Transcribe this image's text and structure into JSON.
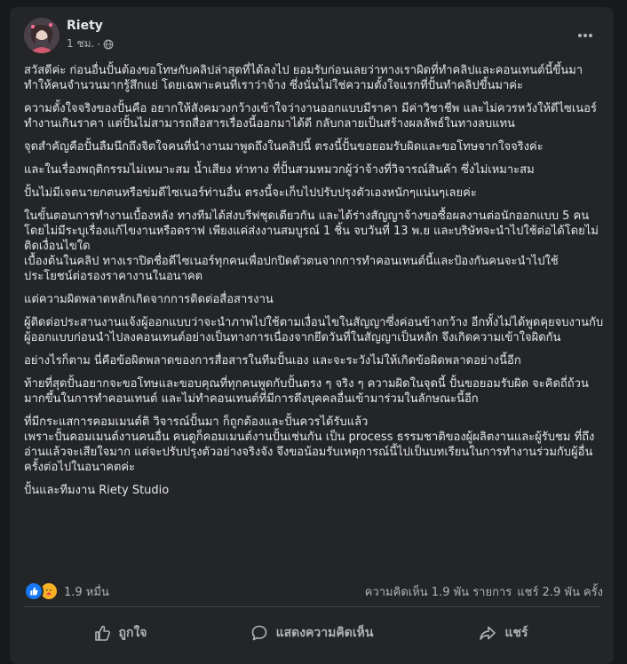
{
  "post": {
    "author": "Riety",
    "time": "1 ชม.",
    "separator": "·",
    "privacy_icon": "globe-icon",
    "paragraphs": [
      "สวัสดีค่ะ ก่อนอื่นปั้นต้องขอโทษกับคลิปล่าสุดที่ได้ลงไป ยอมรับก่อนเลยว่าทางเราผิดที่ทำคลิปและคอนเทนต์นี้ขึ้นมา ทำให้คนจำนวนมากรู้สึกแย่ โดยเฉพาะคนที่เราว่าจ้าง ซึ่งนั่นไม่ใช่ความตั้งใจแรกที่ปั้นทำคลิปขึ้นมาค่ะ",
      "ความตั้งใจจริงของปั้นคือ อยากให้สังคมวงกว้างเข้าใจว่างานออกแบบมีราคา มีค่าวิชาชีพ และไม่ควรหวังให้ดีไซเนอร์ทำงานเกินราคา แต่ปั้นไม่สามารถสื่อสารเรื่องนี้ออกมาได้ดี กลับกลายเป็นสร้างผลลัพธ์ในทางลบแทน",
      "จุดสำคัญคือปั้นลืมนึกถึงจิตใจคนที่นำงานมาพูดถึงในคลิปนี้ ตรงนี้ปั้นขอยอมรับผิดและขอโทษจากใจจริงค่ะ",
      "และในเรื่องพฤติกรรมไม่เหมาะสม น้ำเสียง ท่าทาง ที่ปั้นสวมหมวกผู้ว่าจ้างที่วิจารณ์สินค้า ซึ่งไม่เหมาะสม",
      "ปั้นไม่มีเจตนายกตนหรือข่มดีไซเนอร์ท่านอื่น ตรงนี้จะเก็บไปปรับปรุงตัวเองหนักๆแน่นๆเลยค่ะ",
      "ในขั้นตอนการทำงานเบื้องหลัง ทางทีมได้ส่งบรีฟชุดเดียวกัน และได้ร่างสัญญาจ้างขอซื้อผลงานต่อนักออกแบบ 5 คน โดยไม่มีระบุเรื่องแก้ไขงานหรือดราฟ เพียงแค่ส่งงานสมบูรณ์ 1 ชิ้น จบวันที่ 13 พ.ย และบริษัทจะนำไปใช้ต่อได้โดยไม่ติดเงื่อนไขใด\nเบื้องต้นในคลิป ทางเราปิดชื่อดีไซเนอร์ทุกคนเพื่อปกปิดตัวตนจากการทำคอนเทนต์นี้และป้องกันคนจะนำไปใช้ประโยชน์ต่อรองราคางานในอนาคต",
      "แต่ความผิดพลาดหลักเกิดจากการติดต่อสื่อสารงาน",
      "ผู้ติดต่อประสานงานแจ้งผู้ออกแบบว่าจะนำภาพไปใช้ตามเงื่อนไขในสัญญาซึ่งค่อนข้างกว้าง อีกทั้งไม่ได้พูดคุยจบงานกับผู้ออกแบบก่อนนำไปลงคอนเทนต์อย่างเป็นทางการเนื่องจากยึดวันที่ในสัญญาเป็นหลัก จึงเกิดความเข้าใจผิดกัน",
      "อย่างไรก็ตาม นี่คือข้อผิดพลาดของการสื่อสารในทีมปั้นเอง และจะระวังไม่ให้เกิดข้อผิดพลาดอย่างนี้อีก",
      "ท้ายที่สุดปั้นอยากจะขอโทษและขอบคุณที่ทุกคนพูดกับปั้นตรง ๆ จริง ๆ ความผิดในจุดนี้ ปั้นขอยอมรับผิด จะคิดถี่ถ้วนมากขึ้นในการทำคอนเทนต์ และไม่ทำคอนเทนต์ที่มีการดึงบุคคลอื่นเข้ามาร่วมในลักษณะนี้อีก",
      "ที่มีกระแสการคอมเมนต์ติ วิจารณ์ปั้นมา ก็ถูกต้องและปั้นควรได้รับแล้ว\nเพราะปั้นคอมเมนต์งานคนอื่น คนดูก็คอมเมนต์งานปั้นเช่นกัน เป็น process ธรรมชาติของผู้ผลิตงานและผู้รับชม ที่ถึงอ่านแล้วจะเสียใจมาก แต่จะปรับปรุงตัวอย่างจริงจัง จึงขอน้อมรับเหตุการณ์นี้ไปเป็นบทเรียนในการทำงานร่วมกับผู้อื่นครั้งต่อไปในอนาคตค่ะ",
      "ปั้นและทีมงาน Riety Studio"
    ]
  },
  "stats": {
    "reaction_count": "1.9 หมื่น",
    "reactions": [
      "like",
      "care"
    ],
    "comments": "ความคิดเห็น 1.9 พัน รายการ",
    "shares": "แชร์ 2.9 พัน ครั้ง"
  },
  "actions": {
    "like": "ถูกใจ",
    "comment": "แสดงความคิดเห็น",
    "share": "แชร์"
  },
  "colors": {
    "background": "#18191a",
    "card": "#242526",
    "text_primary": "#e4e6eb",
    "text_secondary": "#b0b3b8",
    "like_blue": "#1877f2",
    "care_yellow": "#f7b125"
  }
}
